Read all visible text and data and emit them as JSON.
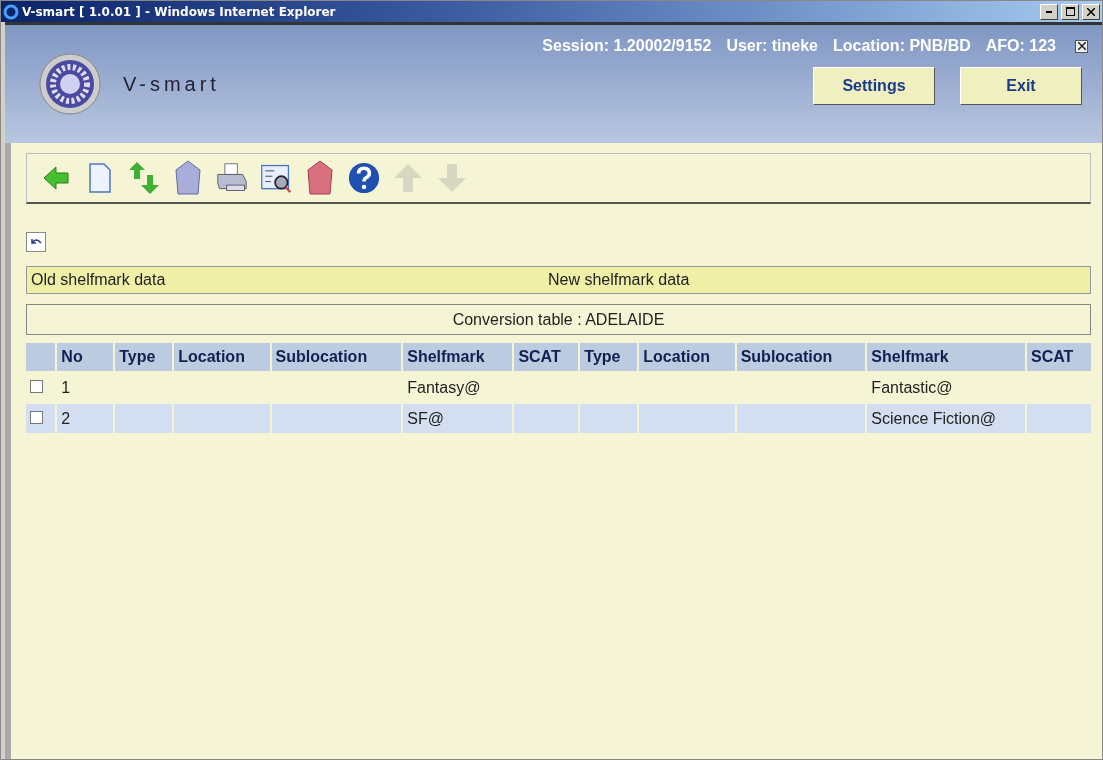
{
  "window": {
    "title": "V-smart [ 1.0.01 ] - Windows Internet Explorer"
  },
  "header": {
    "logo_text": "V-smart",
    "session": "Session: 1.20002/9152",
    "user": "User: tineke",
    "location": "Location: PNB/BD",
    "afo": "AFO: 123",
    "buttons": [
      "Settings",
      "Exit"
    ]
  },
  "toolbar": [
    {
      "kind": "back",
      "disabled": false
    },
    {
      "kind": "new",
      "disabled": false
    },
    {
      "kind": "swap",
      "disabled": false
    },
    {
      "kind": "bin",
      "disabled": false
    },
    {
      "kind": "print",
      "disabled": false
    },
    {
      "kind": "preview",
      "disabled": false
    },
    {
      "kind": "redbin",
      "disabled": false
    },
    {
      "kind": "help",
      "disabled": false
    },
    {
      "kind": "up",
      "disabled": true
    },
    {
      "kind": "down",
      "disabled": true
    }
  ],
  "section_bar": {
    "left": "Old shelfmark data",
    "right": "New shelfmark data"
  },
  "table_caption": "Conversion table : ADELAIDE",
  "table": {
    "columns": [
      "No",
      "Type",
      "Location",
      "Sublocation",
      "Shelfmark",
      "SCAT",
      "Type",
      "Location",
      "Sublocation",
      "Shelfmark",
      "SCAT"
    ],
    "rows": [
      {
        "checked": false,
        "cells": [
          "1",
          "",
          "",
          "",
          "Fantasy@",
          "",
          "",
          "",
          "",
          "Fantastic@",
          ""
        ]
      },
      {
        "checked": false,
        "cells": [
          "2",
          "",
          "",
          "",
          "SF@",
          "",
          "",
          "",
          "",
          "Science Fiction@",
          ""
        ]
      }
    ]
  }
}
